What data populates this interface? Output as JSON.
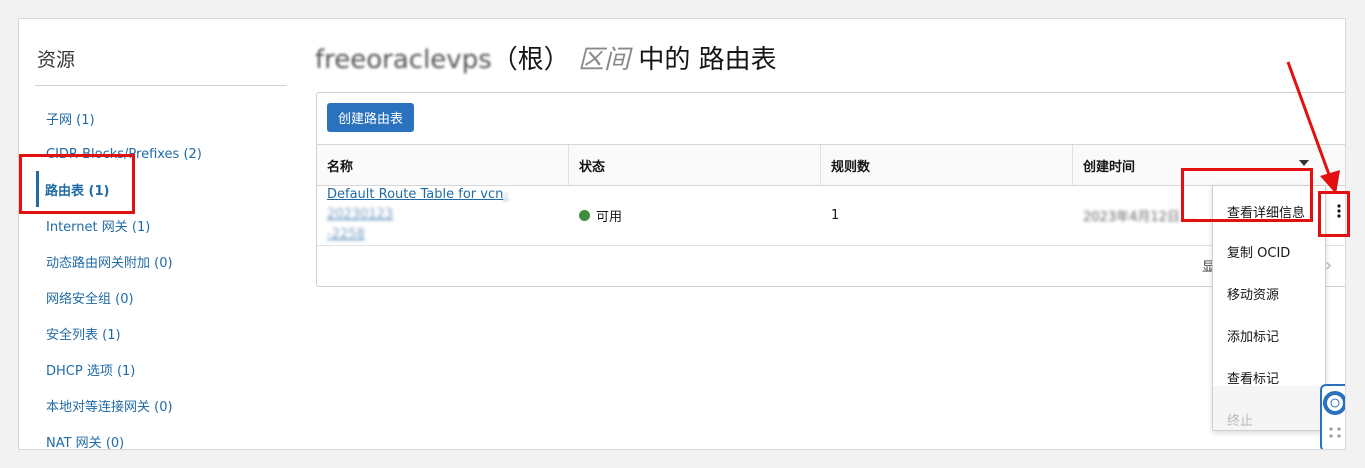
{
  "sidebar": {
    "title": "资源",
    "items": [
      {
        "label": "子网 (1)"
      },
      {
        "label": "CIDR Blocks/Prefixes (2)"
      },
      {
        "label": "路由表 (1)"
      },
      {
        "label": "Internet 网关 (1)"
      },
      {
        "label": "动态路由网关附加 (0)"
      },
      {
        "label": "网络安全组 (0)"
      },
      {
        "label": "安全列表 (1)"
      },
      {
        "label": "DHCP 选项 (1)"
      },
      {
        "label": "本地对等连接网关 (0)"
      },
      {
        "label": "NAT 网关 (0)"
      }
    ]
  },
  "header": {
    "name": "freeoraclevps",
    "root": "（根）",
    "compartment": "区间",
    "suffix": "中的 路由表"
  },
  "toolbar": {
    "create_label": "创建路由表"
  },
  "table": {
    "columns": [
      "名称",
      "状态",
      "规则数",
      "创建时间"
    ],
    "rows": [
      {
        "name": "Default Route Table for vcn",
        "name_blur1": "-20230123",
        "name_blur2": "-2258",
        "status": "可用",
        "rules": "1",
        "created": "2023年4月12日 ..."
      }
    ]
  },
  "pager": {
    "text": "显"
  },
  "row_menu": {
    "items": [
      "查看详细信息",
      "复制 OCID",
      "移动资源",
      "添加标记",
      "查看标记",
      "终止"
    ]
  },
  "colors": {
    "accent": "#2a72bd",
    "link": "#216ba5",
    "status_ok": "#3e8e3e",
    "annotation": "#e21010"
  }
}
